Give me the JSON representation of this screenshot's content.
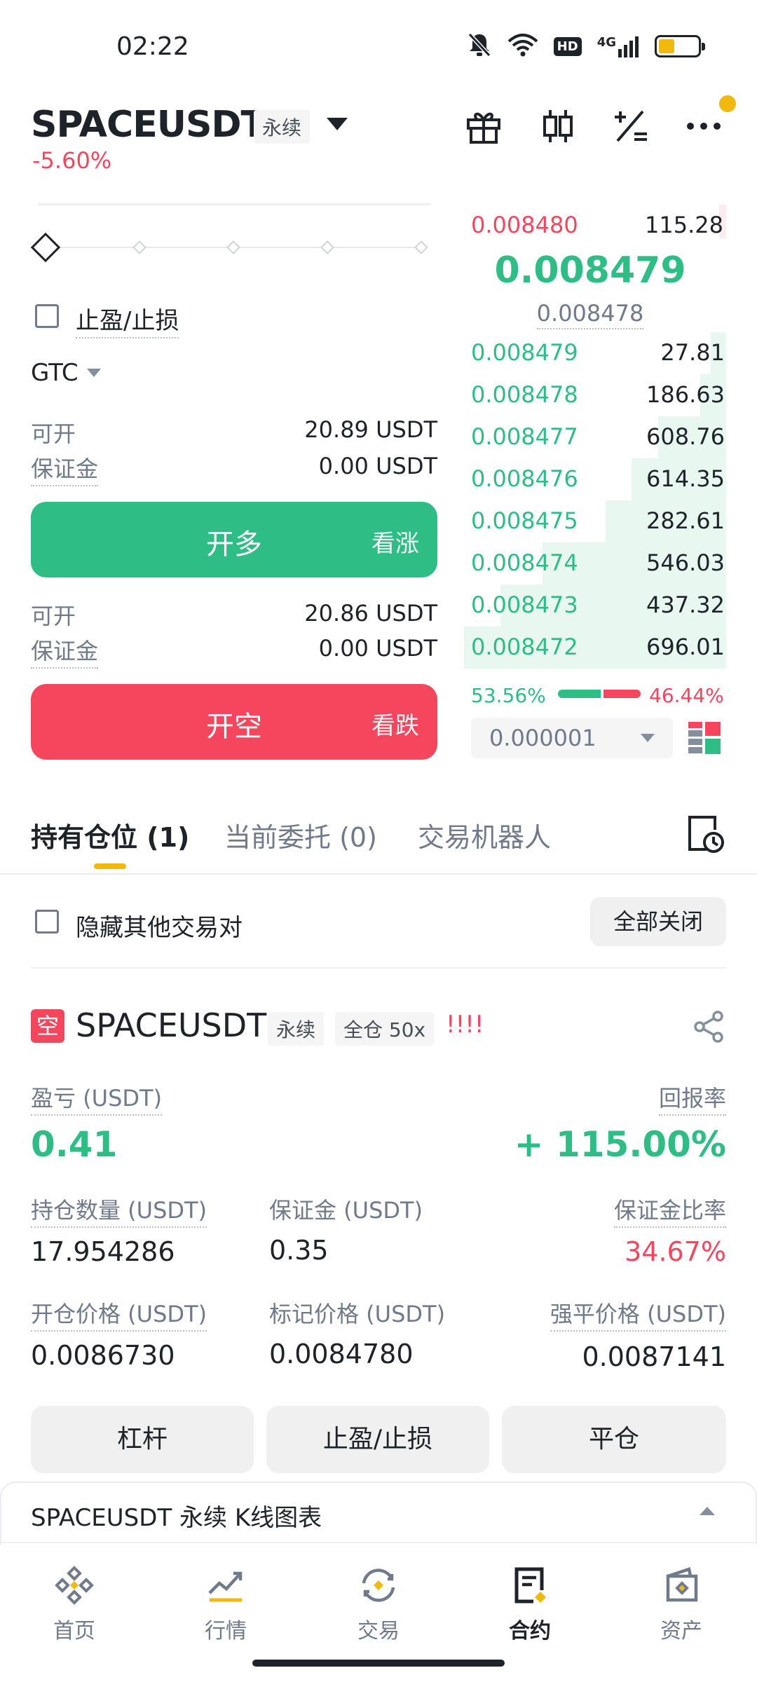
{
  "status_bar": {
    "time": "02:22",
    "network": "4G",
    "hd": "HD"
  },
  "header": {
    "symbol": "SPACEUSDT",
    "contract_type": "永续",
    "change": "-5.60%",
    "icons": [
      "gift-icon",
      "candlestick-icon",
      "calculator-icon",
      "more-icon"
    ]
  },
  "order_form": {
    "tpsl_label": "止盈/止损",
    "tif": "GTC",
    "long": {
      "available_label": "可开",
      "available_value": "20.89 USDT",
      "margin_label": "保证金",
      "margin_value": "0.00 USDT",
      "button_label": "开多",
      "button_hint": "看涨"
    },
    "short": {
      "available_label": "可开",
      "available_value": "20.86 USDT",
      "margin_label": "保证金",
      "margin_value": "0.00 USDT",
      "button_label": "开空",
      "button_hint": "看跌"
    }
  },
  "order_book": {
    "ask": {
      "price": "0.008480",
      "qty": "115.28"
    },
    "last_price": "0.008479",
    "mark_price": "0.008478",
    "bids": [
      {
        "price": "0.008479",
        "qty": "27.81",
        "depth": 0.06
      },
      {
        "price": "0.008478",
        "qty": "186.63",
        "depth": 0.1
      },
      {
        "price": "0.008477",
        "qty": "608.76",
        "depth": 0.26
      },
      {
        "price": "0.008476",
        "qty": "614.35",
        "depth": 0.36
      },
      {
        "price": "0.008475",
        "qty": "282.61",
        "depth": 0.46
      },
      {
        "price": "0.008474",
        "qty": "546.03",
        "depth": 0.7
      },
      {
        "price": "0.008473",
        "qty": "437.32",
        "depth": 0.86
      },
      {
        "price": "0.008472",
        "qty": "696.01",
        "depth": 1.0
      }
    ],
    "buy_ratio": "53.56%",
    "sell_ratio": "46.44%",
    "buy_fraction": 0.5356,
    "precision": "0.000001"
  },
  "tabs": {
    "positions": "持有仓位 (1)",
    "open_orders": "当前委托 (0)",
    "bots": "交易机器人"
  },
  "positions_toolbar": {
    "hide_others": "隐藏其他交易对",
    "close_all": "全部关闭"
  },
  "position": {
    "side_badge": "空",
    "symbol": "SPACEUSDT",
    "contract_type": "永续",
    "margin_mode": "全仓 50x",
    "warning": "!!!!",
    "pnl_label": "盈亏 (USDT)",
    "pnl_value": "0.41",
    "roe_label": "回报率",
    "roe_value": "+ 115.00%",
    "size_label": "持仓数量 (USDT)",
    "size_value": "17.954286",
    "margin_label": "保证金 (USDT)",
    "margin_value": "0.35",
    "margin_ratio_label": "保证金比率",
    "margin_ratio_value": "34.67%",
    "entry_label": "开仓价格 (USDT)",
    "entry_value": "0.0086730",
    "mark_label": "标记价格 (USDT)",
    "mark_value": "0.0084780",
    "liq_label": "强平价格 (USDT)",
    "liq_value": "0.0087141",
    "btn_leverage": "杠杆",
    "btn_tpsl": "止盈/止损",
    "btn_close": "平仓"
  },
  "chart_panel": {
    "title": "SPACEUSDT 永续 K线图表"
  },
  "bottom_nav": [
    {
      "label": "首页",
      "icon": "home-icon"
    },
    {
      "label": "行情",
      "icon": "markets-icon"
    },
    {
      "label": "交易",
      "icon": "trade-icon"
    },
    {
      "label": "合约",
      "icon": "futures-icon"
    },
    {
      "label": "资产",
      "icon": "wallet-icon"
    }
  ],
  "colors": {
    "green": "#2ebd85",
    "red": "#f6465d",
    "accent": "#f0b90b"
  }
}
